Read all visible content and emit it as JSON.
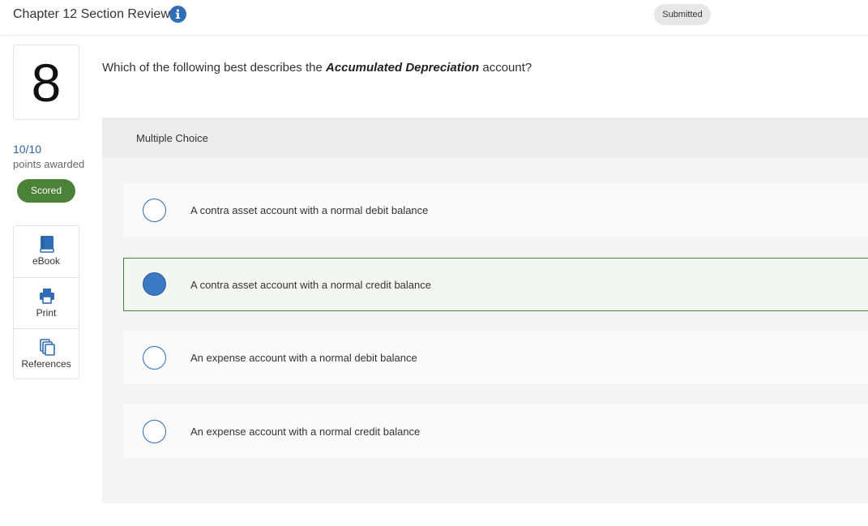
{
  "header": {
    "title": "Chapter 12 Section Review",
    "status_badge": "Submitted"
  },
  "question_panel": {
    "number": "8",
    "score": "10/10",
    "points_label": "points awarded",
    "scored_badge": "Scored"
  },
  "tools": [
    {
      "label": "eBook",
      "icon": "book-icon"
    },
    {
      "label": "Print",
      "icon": "printer-icon"
    },
    {
      "label": "References",
      "icon": "documents-icon"
    }
  ],
  "question": {
    "prefix": "Which of the following best describes the ",
    "emphasis": "Accumulated Depreciation",
    "suffix": " account?"
  },
  "multiple_choice": {
    "label": "Multiple Choice",
    "options": [
      {
        "text": "A contra asset account with a normal debit balance",
        "selected": false
      },
      {
        "text": "A contra asset account with a normal credit balance",
        "selected": true
      },
      {
        "text": "An expense account with a normal debit balance",
        "selected": false
      },
      {
        "text": "An expense account with a normal credit balance",
        "selected": false
      }
    ]
  },
  "colors": {
    "accent_blue": "#2f6db4",
    "scored_green": "#4c8139",
    "selected_fill": "#3a79c4"
  }
}
